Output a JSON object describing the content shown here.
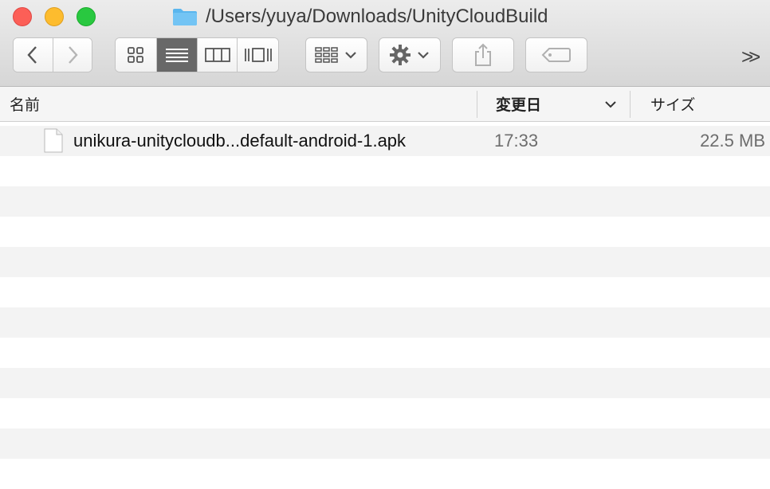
{
  "window": {
    "title": "/Users/yuya/Downloads/UnityCloudBuild",
    "title_icon": "folder-icon"
  },
  "toolbar": {
    "back_icon": "chevron-left-icon",
    "forward_icon": "chevron-right-icon",
    "view_modes": [
      "icon-view",
      "list-view",
      "column-view",
      "cover-flow-view"
    ],
    "active_view": "list-view",
    "arrange_icon": "arrange-grid-icon",
    "action_icon": "gear-icon",
    "share_icon": "share-icon",
    "tag_icon": "tag-icon",
    "overflow_icon": "double-chevron-right-icon",
    "overflow_label": ">>"
  },
  "columns": {
    "name": "名前",
    "date": "変更日",
    "size": "サイズ"
  },
  "files": [
    {
      "name": "unikura-unitycloudb...default-android-1.apk",
      "date": "17:33",
      "size": "22.5 MB",
      "icon": "document-icon"
    }
  ],
  "colors": {
    "close": "#fc5f57",
    "minimize": "#fdbc2e",
    "maximize": "#29c840",
    "folder": "#5ab6ee",
    "active_segment": "#686868"
  }
}
